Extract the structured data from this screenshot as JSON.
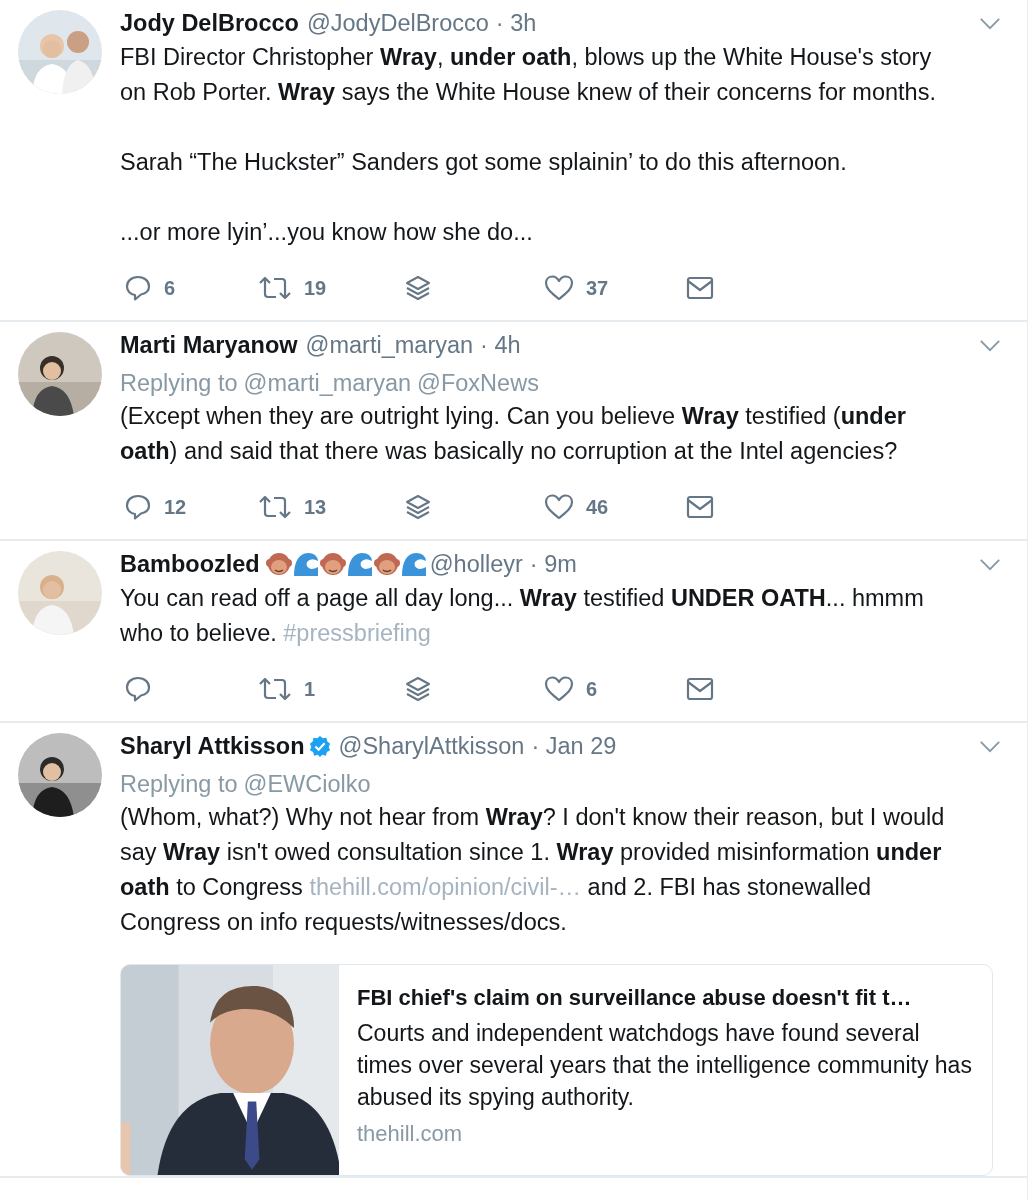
{
  "tweets": [
    {
      "name": "Jody DelBrocco",
      "handle": "@JodyDelBrocco",
      "time": "· 3h",
      "verified": false,
      "avatar": {
        "kind": "picture"
      },
      "paragraphs": [
        [
          {
            "kind": "text",
            "text": "FBI Director Christopher **Wray**, **under oath**, blows up the White House's story on Rob Porter. **Wray** says the White House knew of their concerns for months."
          }
        ],
        [
          {
            "kind": "text",
            "text": "Sarah “The Huckster” Sanders got some splainin’ to do this afternoon."
          }
        ],
        [
          {
            "kind": "text",
            "text": "...or more lyin’...you know how she do..."
          }
        ]
      ],
      "replies": "6",
      "retweets": "19",
      "likes": "37"
    },
    {
      "name": "Marti Maryanow",
      "handle": "@marti_maryan",
      "time": "· 4h",
      "verified": false,
      "avatar": {
        "kind": "picture"
      },
      "replying_to": {
        "label": "Replying to",
        "mentions": [
          "@marti_maryan",
          "@FoxNews"
        ]
      },
      "paragraphs": [
        [
          {
            "kind": "text",
            "text": "(Except when they are outright lying. Can you believe **Wray** testified (**under oath**) and said that there was basically no corruption at the Intel agencies?"
          }
        ]
      ],
      "replies": "12",
      "retweets": "13",
      "likes": "46"
    },
    {
      "name": "Bamboozled",
      "name_emoji": [
        {
          "kind": "monkey"
        },
        {
          "kind": "wave"
        },
        {
          "kind": "monkey"
        },
        {
          "kind": "wave"
        },
        {
          "kind": "monkey"
        },
        {
          "kind": "wave"
        }
      ],
      "handle": "@holleyr",
      "time": "· 9m",
      "verified": false,
      "avatar": {
        "kind": "picture"
      },
      "paragraphs": [
        [
          {
            "kind": "text",
            "text": "You can read off a page all day long... **Wray** testified **UNDER OATH**... hmmm who to believe. "
          },
          {
            "kind": "link",
            "text": "#pressbriefing"
          }
        ]
      ],
      "retweets": "1",
      "likes": "6"
    },
    {
      "name": "Sharyl Attkisson",
      "handle": "@SharylAttkisson",
      "time": "· Jan 29",
      "verified": true,
      "avatar": {
        "kind": "picture"
      },
      "replying_to": {
        "label": "Replying to",
        "mentions": [
          "@EWCiolko"
        ]
      },
      "paragraphs": [
        [
          {
            "kind": "text",
            "text": "(Whom, what?) Why not hear from **Wray**? I don't know their reason, but I would say **Wray** isn't owed consultation since 1. **Wray** provided misinformation **under oath** to Congress "
          },
          {
            "kind": "link",
            "text": "thehill.com/opinion/civil-…"
          },
          {
            "kind": "text",
            "text": " and 2. FBI has stonewalled Congress on info requests/witnesses/docs."
          }
        ]
      ],
      "card": {
        "title": "FBI chief's claim on surveillance abuse doesn't fit t…",
        "description": "Courts and independent watchdogs have found several times over several years that the intelligence community has abused its spying authority.",
        "domain": "thehill.com"
      }
    }
  ]
}
